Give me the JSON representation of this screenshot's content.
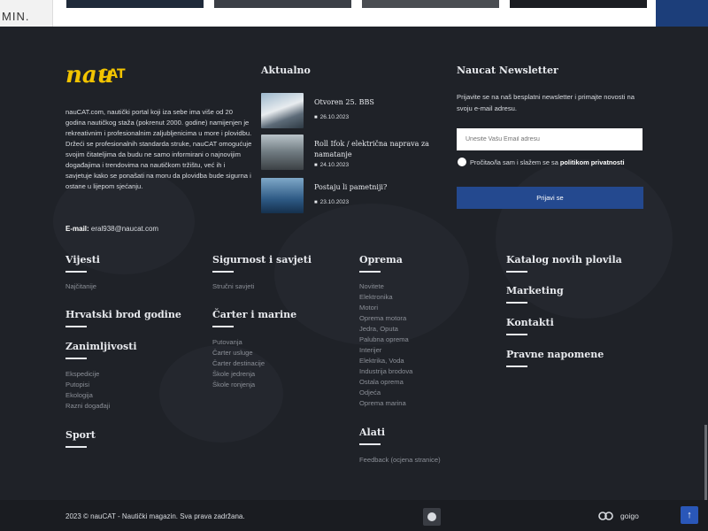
{
  "top": {
    "logo_fragment": "MIN."
  },
  "brand": {
    "logo_nau": "nau",
    "logo_cat": "CAT",
    "description": "nauCAT.com, nautički portal koji iza sebe ima više od 20 godina nautičkog staža (pokrenut 2000. godine) namijenjen je rekreativnim i profesionalnim zaljubljenicima u more i plovidbu. Držeći se profesionalnih standarda struke, nauCAT omogućuje svojim čitateljima da budu ne samo informirani o najnovijim događajima i trendovima na nautičkom tržištu, već ih i savjetuje kako se ponašati na moru da plovidba bude sigurna i ostane u lijepom sjećanju.",
    "email_label": "E-mail:",
    "email_value": "eral938@naucat.com"
  },
  "news": {
    "heading": "Aktualno",
    "items": [
      {
        "title": "Otvoren 25. BBS",
        "date": "26.10.2023"
      },
      {
        "title": "Roll Ifok / električna naprava za namatanje",
        "date": "24.10.2023"
      },
      {
        "title": "Postaju li pametniji?",
        "date": "23.10.2023"
      }
    ]
  },
  "newsletter": {
    "heading": "Naucat Newsletter",
    "text": "Prijavite se na naš besplatni newsletter i primajte novosti na svoju e-mail adresu.",
    "email_placeholder": "Unesite Vašu Email adresu",
    "consent_text": "Pročitao/la sam i slažem se sa",
    "consent_link": "politikom privatnosti",
    "submit_label": "Prijavi se"
  },
  "columns": {
    "col1": {
      "vijesti": {
        "heading": "Vijesti",
        "links": [
          "Najčitanije"
        ]
      },
      "hrvatski": {
        "heading": "Hrvatski brod godine"
      },
      "zanimljivosti": {
        "heading": "Zanimljivosti",
        "links": [
          "Ekspedicije",
          "Putopisi",
          "Ekologija",
          "Razni događaji"
        ]
      },
      "sport": {
        "heading": "Sport"
      }
    },
    "col2": {
      "sigurnost": {
        "heading": "Sigurnost i savjeti",
        "links": [
          "Stručni savjeti"
        ]
      },
      "carter": {
        "heading": "Čarter i marine",
        "links": [
          "Putovanja",
          "Čarter usluge",
          "Čarter destinacije",
          "Škole jedrenja",
          "Škole ronjenja"
        ]
      }
    },
    "col3": {
      "oprema": {
        "heading": "Oprema",
        "links": [
          "Novitete",
          "Elektronika",
          "Motori",
          "Oprema motora",
          "Jedra, Oputa",
          "Palubna oprema",
          "Interijer",
          "Elektrika, Voda",
          "Industrija brodova",
          "Ostala oprema",
          "Odjeća",
          "Oprema marina"
        ]
      },
      "alati": {
        "heading": "Alati",
        "links": [
          "Feedback (ocjena stranice)"
        ]
      }
    },
    "col4": {
      "katalog": {
        "heading": "Katalog novih plovila"
      },
      "marketing": {
        "heading": "Marketing"
      },
      "kontakti": {
        "heading": "Kontakti"
      },
      "pravne": {
        "heading": "Pravne napomene"
      }
    }
  },
  "bottom": {
    "copyright": "2023 © nauCAT - Nautički magazin. Sva prava zadržana.",
    "goigo": "goigo",
    "to_top_icon": "↑"
  },
  "colors": {
    "background": "#1f2228",
    "accent_button": "#24498f",
    "logo_yellow": "#f2c400"
  }
}
